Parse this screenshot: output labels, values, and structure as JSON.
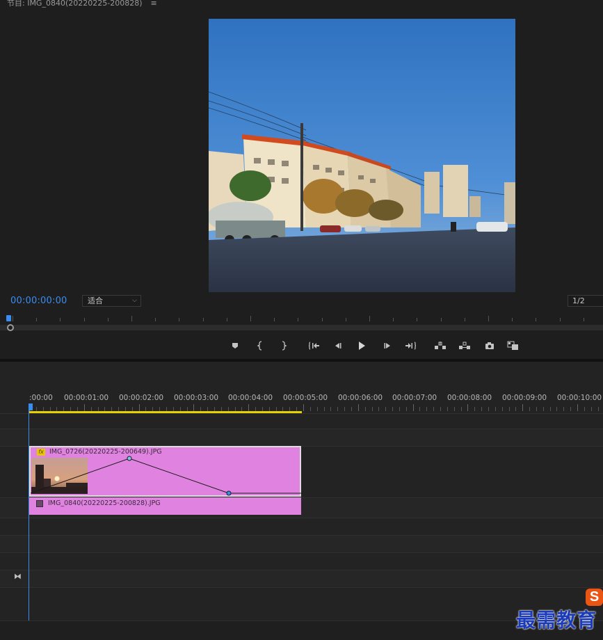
{
  "monitor": {
    "title": "节目: IMG_0840(20220225-200828)",
    "menu_icon": "hamburger-icon",
    "timecode": "00:00:00:00",
    "fit_value": "适合",
    "resolution_value": "1/2"
  },
  "transport": {
    "buttons": [
      {
        "name": "add-marker",
        "icon": "marker-icon"
      },
      {
        "name": "mark-in",
        "icon": "mark-in-icon"
      },
      {
        "name": "mark-out",
        "icon": "mark-out-icon"
      },
      {
        "name": "go-to-in",
        "icon": "go-to-in-icon"
      },
      {
        "name": "step-back",
        "icon": "step-back-icon"
      },
      {
        "name": "play",
        "icon": "play-icon"
      },
      {
        "name": "step-forward",
        "icon": "step-forward-icon"
      },
      {
        "name": "go-to-out",
        "icon": "go-to-out-icon"
      },
      {
        "name": "lift",
        "icon": "lift-icon"
      },
      {
        "name": "extract",
        "icon": "extract-icon"
      },
      {
        "name": "export-frame",
        "icon": "camera-icon"
      },
      {
        "name": "compare-view",
        "icon": "compare-icon"
      }
    ]
  },
  "timeline": {
    "ruler_labels": [
      ":00:00",
      "00:00:01:00",
      "00:00:02:00",
      "00:00:03:00",
      "00:00:04:00",
      "00:00:05:00",
      "00:00:06:00",
      "00:00:07:00",
      "00:00:08:00",
      "00:00:09:00",
      "00:00:10:00"
    ],
    "clips": {
      "v2_name": "IMG_0726(20220225-200649).JPG",
      "v2_badge": "fx",
      "v1_name": "IMG_0840(20220225-200828).JPG"
    },
    "keyframes": {
      "comment_free_values_percent": [
        0,
        100,
        0
      ],
      "times_seconds": [
        0,
        1.8,
        3.6
      ]
    }
  },
  "watermark": {
    "text": "最需教育",
    "badge": "S"
  },
  "colors": {
    "accent_blue": "#3a8df0",
    "clip_pink": "#e083e0",
    "work_area_yellow": "#e8d100"
  }
}
